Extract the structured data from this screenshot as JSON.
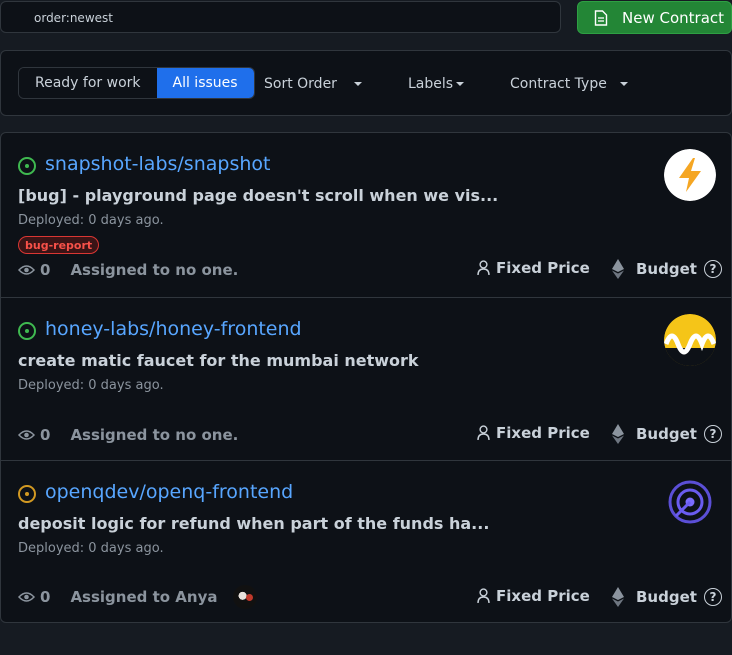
{
  "search": {
    "value": "order:newest"
  },
  "new_contract": {
    "label": "New Contract"
  },
  "filters": {
    "ready_label": "Ready for work",
    "all_label": "All issues",
    "sort_label": "Sort Order",
    "labels_label": "Labels",
    "contract_type_label": "Contract Type"
  },
  "issues": [
    {
      "repo": "snapshot-labs/snapshot",
      "title": "[bug] - playground page doesn't scroll when we vis...",
      "deployed": "Deployed: 0 days ago.",
      "label": "bug-report",
      "watchers": "0",
      "assigned": "Assigned to no one.",
      "price_type": "Fixed Price",
      "budget": "Budget",
      "help": "?",
      "status_color": "#3fb950"
    },
    {
      "repo": "honey-labs/honey-frontend",
      "title": "create matic faucet for the mumbai network",
      "deployed": "Deployed: 0 days ago.",
      "watchers": "0",
      "assigned": "Assigned to no one.",
      "price_type": "Fixed Price",
      "budget": "Budget",
      "help": "?",
      "status_color": "#3fb950"
    },
    {
      "repo": "openqdev/openq-frontend",
      "title": "deposit logic for refund when part of the funds ha...",
      "deployed": "Deployed: 0 days ago.",
      "watchers": "0",
      "assigned": "Assigned to Anya",
      "price_type": "Fixed Price",
      "budget": "Budget",
      "help": "?",
      "status_color": "#d29922"
    }
  ],
  "colors": {
    "accent_blue": "#1f6feb",
    "link_blue": "#58a6ff",
    "green": "#238636",
    "bug_red": "#f85149"
  }
}
